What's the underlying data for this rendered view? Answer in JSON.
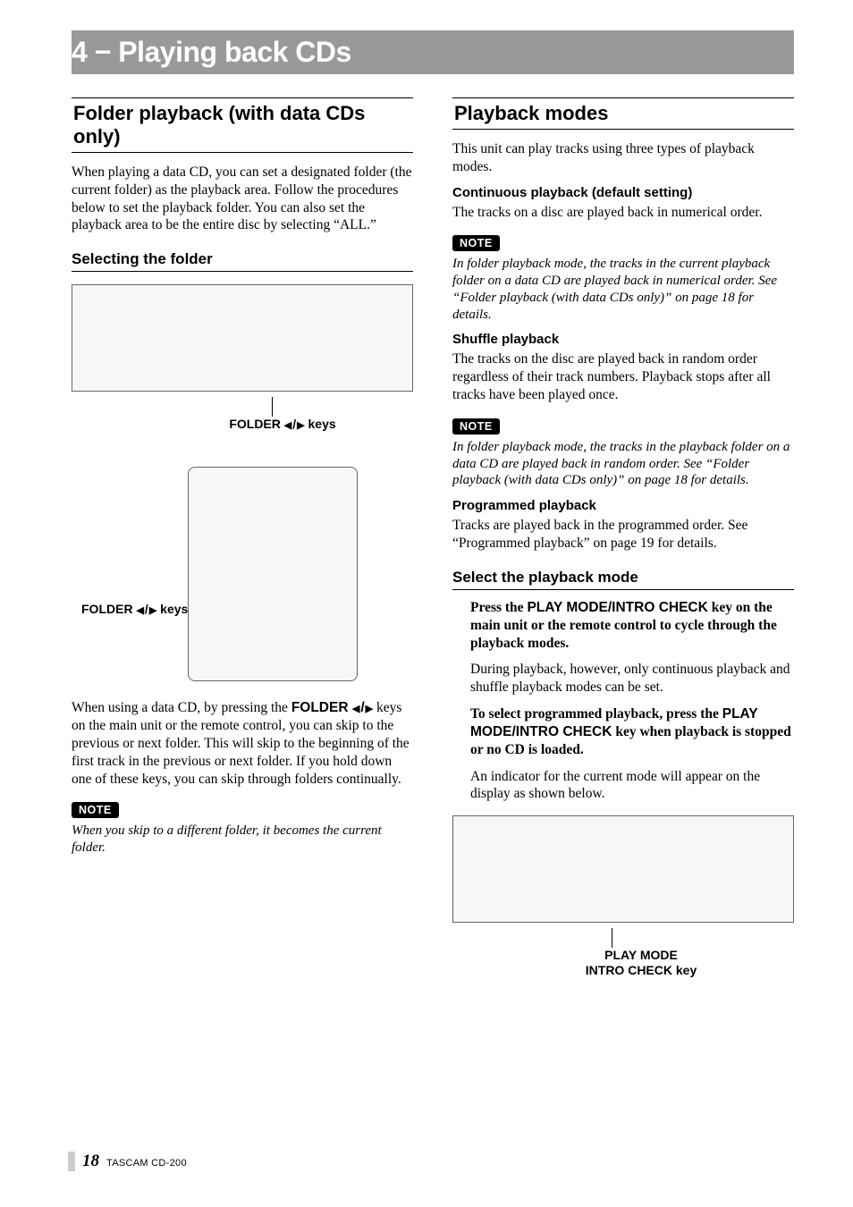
{
  "chapter": {
    "title": "4 − Playing back CDs"
  },
  "left": {
    "h2": "Folder playback (with data CDs only)",
    "intro": "When playing a data CD, you can set a designated folder (the current folder) as the playback area. Follow the procedures below to set the playback folder. You can also set the playback area to be the entire disc by selecting “ALL.”",
    "h3": "Selecting the folder",
    "callout1_prefix": "FOLDER ",
    "callout1_suffix": " keys",
    "callout2_prefix": "FOLDER ",
    "callout2_suffix": " keys",
    "para2a": "When using a data CD, by pressing the ",
    "para2_btn": "FOLDER ",
    "para2b": " keys on the main unit or the remote control, you can skip to the previous or next folder. This will skip to the beginning of the first track in the previous or next folder. If you hold down one of these keys, you can skip through folders continually.",
    "note_tag": "NOTE",
    "note1": "When you skip to a different folder, it becomes the current folder."
  },
  "right": {
    "h2": "Playback modes",
    "intro": "This unit can play tracks using three types of playback modes.",
    "mode1_h": "Continuous playback (default setting)",
    "mode1_p": "The tracks on a disc are played back in numerical order.",
    "note_tag": "NOTE",
    "note1": "In folder playback mode, the tracks in the current playback folder on a data CD are played back in numerical order. See “Folder playback (with data CDs only)” on page 18 for details.",
    "mode2_h": "Shuffle playback",
    "mode2_p": "The tracks on the disc are played back in random order regardless of their track numbers. Playback stops after all tracks have been played once.",
    "note2": "In folder playback mode, the tracks in the playback folder on a data CD are played back in random order. See “Folder playback (with data CDs only)” on page 18 for details.",
    "mode3_h": "Programmed playback",
    "mode3_p": "Tracks are played back in the programmed order. See “Programmed playback” on page 19 for details.",
    "h3": "Select the playback mode",
    "step1a": "Press the ",
    "step1_btn": "PLAY MODE/INTRO CHECK",
    "step1b": " key on the main unit or the remote control to cycle through the playback modes.",
    "step1_note": "During playback, however, only continuous playback and shuffle playback modes can be set.",
    "step2a": "To select programmed playback, press the ",
    "step2_btn": "PLAY MODE/INTRO CHECK",
    "step2b": " key when playback is stopped or no CD is loaded.",
    "step3": "An indicator for the current mode will appear on the display as shown below.",
    "callout_line1": "PLAY MODE",
    "callout_line2": "INTRO CHECK key"
  },
  "footer": {
    "page": "18",
    "model": "TASCAM  CD-200"
  }
}
